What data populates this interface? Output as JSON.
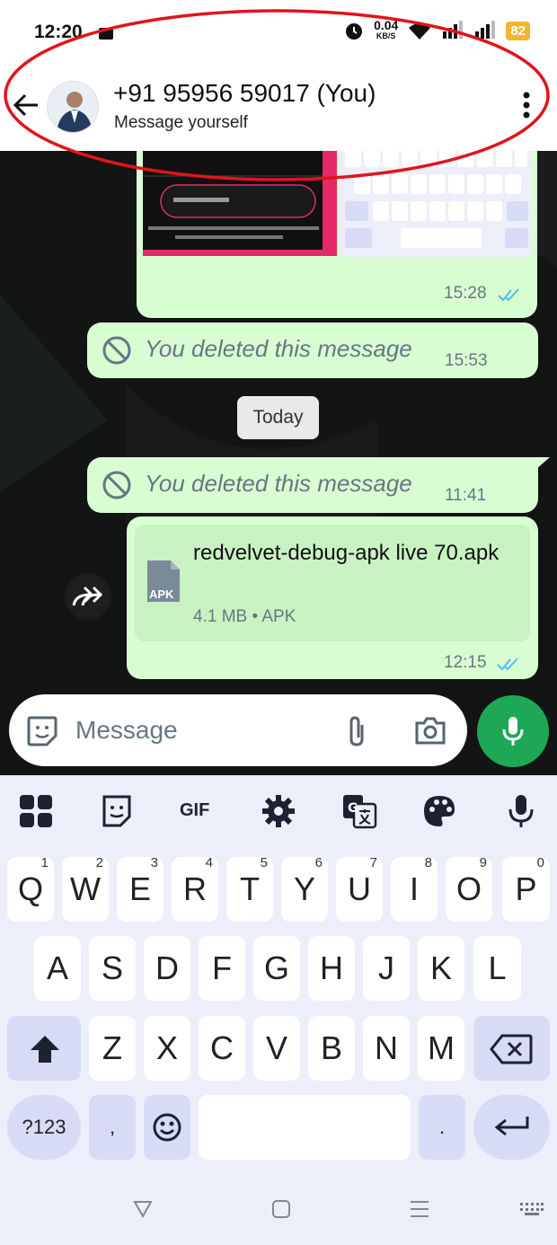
{
  "status": {
    "time": "12:20",
    "speed": "0.04",
    "speed_unit": "KB/S",
    "battery": "82"
  },
  "header": {
    "name": "+91 95956 59017 (You)",
    "subtitle": "Message yourself"
  },
  "messages": {
    "screenshot_time": "15:28",
    "deleted_text": "You deleted this message",
    "deleted1_time": "15:53",
    "date_chip": "Today",
    "deleted2_time": "11:41",
    "file_name": "redvelvet-debug-apk live 70.apk",
    "file_meta": "4.1 MB • APK",
    "file_badge": "APK",
    "file_time": "12:15"
  },
  "composer": {
    "placeholder": "Message"
  },
  "keyboard": {
    "toolbar_gif": "GIF",
    "row1": [
      "Q",
      "W",
      "E",
      "R",
      "T",
      "Y",
      "U",
      "I",
      "O",
      "P"
    ],
    "row1_hints": [
      "1",
      "2",
      "3",
      "4",
      "5",
      "6",
      "7",
      "8",
      "9",
      "0"
    ],
    "row2": [
      "A",
      "S",
      "D",
      "F",
      "G",
      "H",
      "J",
      "K",
      "L"
    ],
    "row3": [
      "Z",
      "X",
      "C",
      "V",
      "B",
      "N",
      "M"
    ],
    "numbers_label": "?123",
    "comma": ",",
    "period": "."
  },
  "colors": {
    "bubble": "#d9fdd3",
    "accent": "#1ea855",
    "annotation": "#e0151b",
    "ticks": "#53bdeb"
  }
}
